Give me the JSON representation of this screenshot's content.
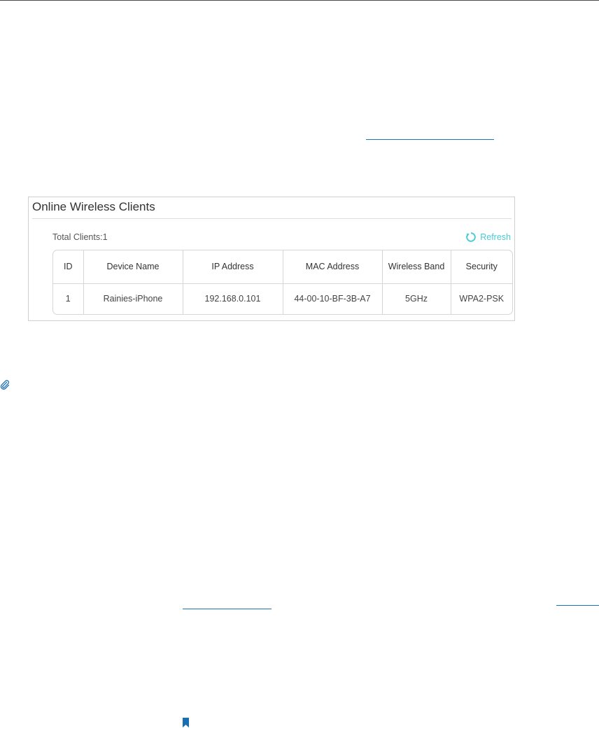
{
  "panel": {
    "title": "Online Wireless Clients",
    "total_label": "Total Clients:",
    "total_value": "1",
    "refresh_label": "Refresh"
  },
  "table": {
    "headers": [
      "ID",
      "Device Name",
      "IP Address",
      "MAC Address",
      "Wireless Band",
      "Security"
    ],
    "rows": [
      [
        "1",
        "Rainies-iPhone",
        "192.168.0.101",
        "44-00-10-BF-3B-A7",
        "5GHz",
        "WPA2-PSK"
      ]
    ]
  },
  "colors": {
    "accent": "#4acbd6",
    "link": "#1a76b8",
    "note_icon": "#1a6fb0"
  },
  "icons": {
    "refresh": "refresh-icon",
    "note": "paperclip-icon",
    "bookmark": "bookmark-icon"
  }
}
